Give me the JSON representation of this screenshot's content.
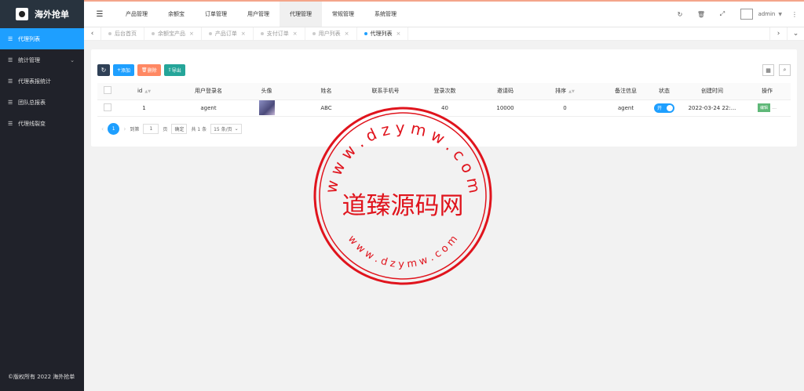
{
  "app": {
    "title": "海外抢单",
    "copyright": "©版权所有 2022 海外抢单"
  },
  "sidebar": {
    "items": [
      {
        "label": "代理列表",
        "active": true
      },
      {
        "label": "统计管理",
        "has_children": true
      },
      {
        "label": "代理表报统计"
      },
      {
        "label": "团队总报表"
      },
      {
        "label": "代理线裂变"
      }
    ]
  },
  "header": {
    "nav": [
      "产品管理",
      "余额宝",
      "订单管理",
      "用户管理",
      "代理管理",
      "常规管理",
      "系统管理"
    ],
    "active_nav": "代理管理",
    "user": "admin"
  },
  "tabs": [
    {
      "label": "后台首页",
      "closable": false
    },
    {
      "label": "余额宝产品",
      "closable": true
    },
    {
      "label": "产品订单",
      "closable": true
    },
    {
      "label": "支付订单",
      "closable": true
    },
    {
      "label": "用户列表",
      "closable": true
    },
    {
      "label": "代理列表",
      "closable": true,
      "active": true
    }
  ],
  "toolbar": {
    "add": "添加",
    "delete": "删除",
    "export": "导出"
  },
  "table": {
    "columns": [
      "id",
      "用户登录名",
      "头像",
      "姓名",
      "联系手机号",
      "登录次数",
      "邀请码",
      "排序",
      "备注信息",
      "状态",
      "创建时间",
      "操作"
    ],
    "rows": [
      {
        "id": "1",
        "login": "agent",
        "name": "ABC",
        "phone": "",
        "logins": "40",
        "invite": "10000",
        "sort": "0",
        "remark": "agent",
        "status": "开",
        "created": "2022-03-24 22:...",
        "action": "编辑"
      }
    ]
  },
  "pager": {
    "current": "1",
    "goto_label": "到第",
    "goto_value": "1",
    "page_label": "页",
    "confirm": "确定",
    "total": "共 1 条",
    "per_page": "15 条/页"
  },
  "watermark": {
    "center": "道臻源码网",
    "top_ring": "w w w . d z y m w . c o m",
    "bottom_ring": "w w w . d z y m w . c o m"
  },
  "colors": {
    "primary": "#1e9fff",
    "sidebar": "#20222a",
    "seal": "#e0141d"
  }
}
